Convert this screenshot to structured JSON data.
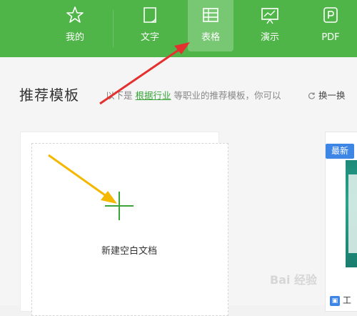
{
  "nav": {
    "tabs": [
      {
        "label": "我的",
        "icon": "star-icon"
      },
      {
        "label": "文字",
        "icon": "document-icon"
      },
      {
        "label": "表格",
        "icon": "spreadsheet-icon"
      },
      {
        "label": "演示",
        "icon": "presentation-icon"
      },
      {
        "label": "PDF",
        "icon": "pdf-icon"
      }
    ],
    "active": "表格",
    "color": "#4fb548"
  },
  "section": {
    "title": "推荐模板",
    "hint_prefix": "以下是",
    "hint_link": "根据行业",
    "hint_suffix": "等职业的推荐模板，你可以",
    "refresh_label": "换一换"
  },
  "blank": {
    "label": "新建空白文档"
  },
  "template": {
    "badge": "最新",
    "name_partial": "工"
  },
  "watermark": "Bai 经验"
}
